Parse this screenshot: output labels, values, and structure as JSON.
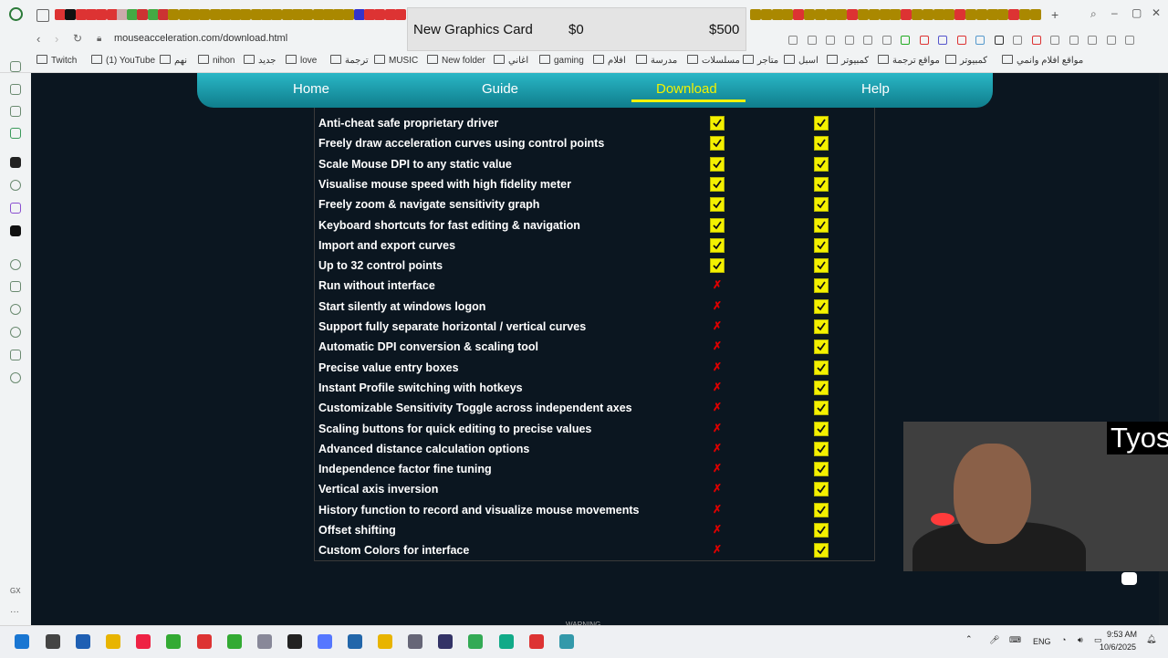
{
  "browser": {
    "url": "mouseacceleration.com/download.html",
    "bookmarks": [
      "Twitch",
      "(1) YouTube",
      "نهم",
      "nihon",
      "جديد",
      "love",
      "ترجمة",
      "MUSIC",
      "New folder",
      "اغاني",
      "gaming",
      "افلام",
      "مدرسة",
      "مسلسلات",
      "متاجر",
      "اسبل",
      "كمبيوتر",
      "مواقع ترجمة",
      "كمبيوتر",
      "مواقع افلام وانمي"
    ]
  },
  "overlay": {
    "item": "New Graphics Card",
    "current": "$0",
    "goal": "$500"
  },
  "nav": {
    "items": [
      "Home",
      "Guide",
      "Download",
      "Help"
    ],
    "active": "Download",
    "active_color": "#f2f200"
  },
  "features": [
    {
      "label": "Anti-cheat safe proprietary driver",
      "free": true,
      "pro": true
    },
    {
      "label": "Freely draw acceleration curves using control points",
      "free": true,
      "pro": true
    },
    {
      "label": "Scale Mouse DPI to any static value",
      "free": true,
      "pro": true
    },
    {
      "label": "Visualise mouse speed with high fidelity meter",
      "free": true,
      "pro": true
    },
    {
      "label": "Freely zoom & navigate sensitivity graph",
      "free": true,
      "pro": true
    },
    {
      "label": "Keyboard shortcuts for fast editing & navigation",
      "free": true,
      "pro": true
    },
    {
      "label": "Import and export curves",
      "free": true,
      "pro": true
    },
    {
      "label": "Up to 32 control points",
      "free": true,
      "pro": true
    },
    {
      "label": "Run without interface",
      "free": false,
      "pro": true
    },
    {
      "label": "Start silently at windows logon",
      "free": false,
      "pro": true
    },
    {
      "label": "Support fully separate horizontal / vertical curves",
      "free": false,
      "pro": true
    },
    {
      "label": "Automatic DPI conversion & scaling tool",
      "free": false,
      "pro": true
    },
    {
      "label": "Precise value entry boxes",
      "free": false,
      "pro": true
    },
    {
      "label": "Instant Profile switching with hotkeys",
      "free": false,
      "pro": true
    },
    {
      "label": "Customizable Sensitivity Toggle across independent axes",
      "free": false,
      "pro": true
    },
    {
      "label": "Scaling buttons for quick editing to precise values",
      "free": false,
      "pro": true
    },
    {
      "label": "Advanced distance calculation options",
      "free": false,
      "pro": true
    },
    {
      "label": "Independence factor fine tuning",
      "free": false,
      "pro": true
    },
    {
      "label": "Vertical axis inversion",
      "free": false,
      "pro": true
    },
    {
      "label": "History function to record and visualize mouse movements",
      "free": false,
      "pro": true
    },
    {
      "label": "Offset shifting",
      "free": false,
      "pro": true
    },
    {
      "label": "Custom Colors for interface",
      "free": false,
      "pro": true
    }
  ],
  "marks": {
    "check_color": "#f4f000",
    "cross_glyph": "✗",
    "cross_color": "#dd0000"
  },
  "webcam": {
    "name": "Tyos"
  },
  "page_footer_text": "WARNING",
  "taskbar": {
    "lang": "ENG",
    "time": "9:53 AM",
    "date": "10/6/2025"
  }
}
